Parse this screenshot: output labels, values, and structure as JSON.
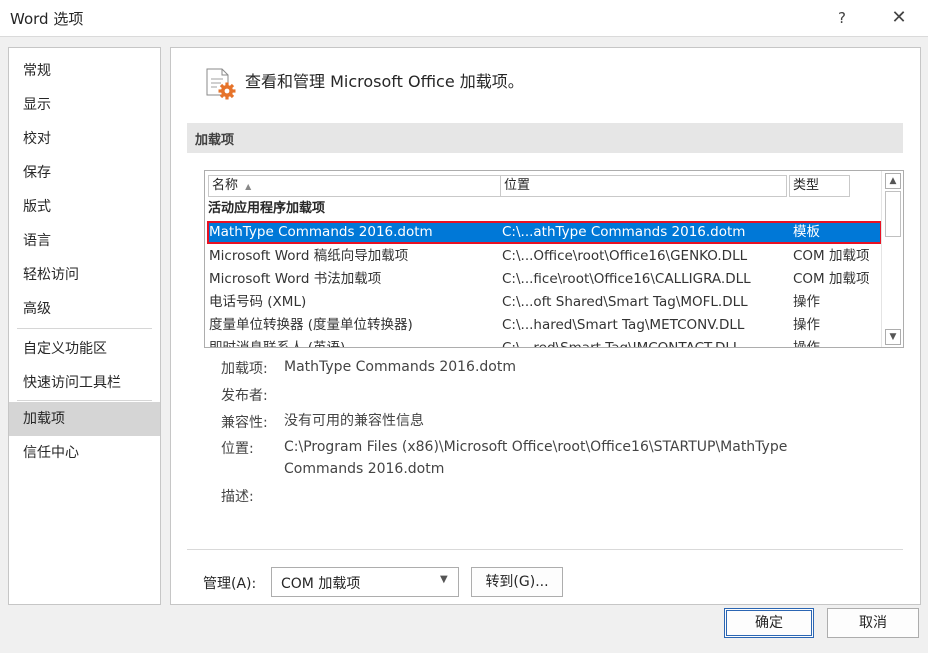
{
  "window": {
    "title": "Word 选项",
    "help": "?",
    "close": "✕"
  },
  "nav": {
    "items": [
      "常规",
      "显示",
      "校对",
      "保存",
      "版式",
      "语言",
      "轻松访问",
      "高级",
      "自定义功能区",
      "快速访问工具栏",
      "加载项",
      "信任中心"
    ],
    "selected_index": 10
  },
  "main": {
    "header": "查看和管理 Microsoft Office 加载项。",
    "section_title": "加载项",
    "columns": {
      "name": "名称",
      "sort_indicator": "▲",
      "location": "位置",
      "type": "类型"
    },
    "group_label": "活动应用程序加载项",
    "rows": [
      {
        "name": "MathType Commands 2016.dotm",
        "location": "C:\\...athType Commands 2016.dotm",
        "type": "模板"
      },
      {
        "name": "Microsoft Word 稿纸向导加载项",
        "location": "C:\\...Office\\root\\Office16\\GENKO.DLL",
        "type": "COM 加载项"
      },
      {
        "name": "Microsoft Word 书法加载项",
        "location": "C:\\...fice\\root\\Office16\\CALLIGRA.DLL",
        "type": "COM 加载项"
      },
      {
        "name": "电话号码 (XML)",
        "location": "C:\\...oft Shared\\Smart Tag\\MOFL.DLL",
        "type": "操作"
      },
      {
        "name": "度量单位转换器 (度量单位转换器)",
        "location": "C:\\...hared\\Smart Tag\\METCONV.DLL",
        "type": "操作"
      },
      {
        "name": "即时消息联系人 (英语)",
        "location": "C:\\...red\\Smart Tag\\IMCONTACT.DLL",
        "type": "操作"
      }
    ],
    "details": {
      "addin_label": "加载项:",
      "addin_value": "MathType Commands 2016.dotm",
      "publisher_label": "发布者:",
      "publisher_value": "",
      "compat_label": "兼容性:",
      "compat_value": "没有可用的兼容性信息",
      "location_label": "位置:",
      "location_value_line1": "C:\\Program Files (x86)\\Microsoft Office\\root\\Office16\\STARTUP\\MathType",
      "location_value_line2": "Commands 2016.dotm",
      "description_label": "描述:",
      "description_value": ""
    },
    "manage": {
      "label": "管理(A):",
      "selected": "COM 加载项",
      "arrow": "▼",
      "goto": "转到(G)..."
    }
  },
  "footer": {
    "ok": "确定",
    "cancel": "取消"
  },
  "scroll": {
    "up": "▲",
    "down": "▼"
  },
  "colors": {
    "selection": "#0078d7",
    "highlight_outline": "#e81123",
    "nav_selected": "#d5d5d5",
    "icon_accent": "#e6732a"
  }
}
